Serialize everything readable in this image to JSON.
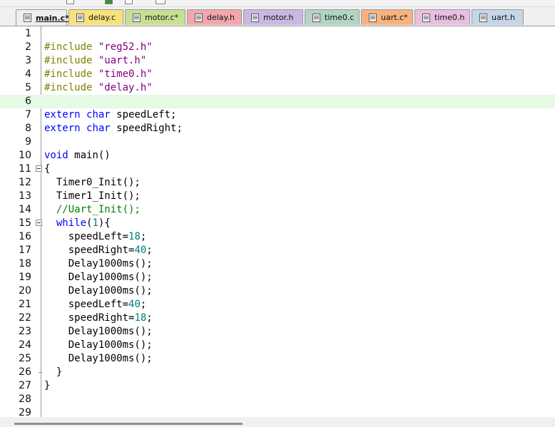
{
  "tabs": [
    {
      "label": "main.c*",
      "color": "#eeeeee",
      "active": true
    },
    {
      "label": "delay.c",
      "color": "#f9e27d"
    },
    {
      "label": "motor.c*",
      "color": "#c7df93"
    },
    {
      "label": "delay.h",
      "color": "#f3a6ad"
    },
    {
      "label": "motor.h",
      "color": "#c9b8e3"
    },
    {
      "label": "time0.c",
      "color": "#b2d4c3"
    },
    {
      "label": "uart.c*",
      "color": "#f7b27e"
    },
    {
      "label": "time0.h",
      "color": "#e8bfe0"
    },
    {
      "label": "uart.h",
      "color": "#c6d6e8"
    }
  ],
  "editor": {
    "current_line": 6,
    "lines": [
      {
        "n": "1",
        "tokens": []
      },
      {
        "n": "2",
        "tokens": [
          {
            "t": "#include ",
            "c": "pp"
          },
          {
            "t": "\"reg52.h\"",
            "c": "str"
          }
        ]
      },
      {
        "n": "3",
        "tokens": [
          {
            "t": "#include ",
            "c": "pp"
          },
          {
            "t": "\"uart.h\"",
            "c": "str"
          }
        ]
      },
      {
        "n": "4",
        "tokens": [
          {
            "t": "#include ",
            "c": "pp"
          },
          {
            "t": "\"time0.h\"",
            "c": "str"
          }
        ]
      },
      {
        "n": "5",
        "tokens": [
          {
            "t": "#include ",
            "c": "pp"
          },
          {
            "t": "\"delay.h\"",
            "c": "str"
          }
        ]
      },
      {
        "n": "6",
        "tokens": []
      },
      {
        "n": "7",
        "tokens": [
          {
            "t": "extern ",
            "c": "kw"
          },
          {
            "t": "char ",
            "c": "kw"
          },
          {
            "t": "speedLeft;",
            "c": ""
          }
        ]
      },
      {
        "n": "8",
        "tokens": [
          {
            "t": "extern ",
            "c": "kw"
          },
          {
            "t": "char ",
            "c": "kw"
          },
          {
            "t": "speedRight;",
            "c": ""
          }
        ]
      },
      {
        "n": "9",
        "tokens": []
      },
      {
        "n": "10",
        "tokens": [
          {
            "t": "void ",
            "c": "kw"
          },
          {
            "t": "main()",
            "c": ""
          }
        ]
      },
      {
        "n": "11",
        "fold": true,
        "tokens": [
          {
            "t": "{",
            "c": ""
          }
        ]
      },
      {
        "n": "12",
        "tokens": [
          {
            "t": "  Timer0_Init();",
            "c": ""
          }
        ]
      },
      {
        "n": "13",
        "tokens": [
          {
            "t": "  Timer1_Init();",
            "c": ""
          }
        ]
      },
      {
        "n": "14",
        "tokens": [
          {
            "t": "  //Uart_Init();",
            "c": "cmt"
          }
        ]
      },
      {
        "n": "15",
        "fold": true,
        "tokens": [
          {
            "t": "  ",
            "c": ""
          },
          {
            "t": "while",
            "c": "kw"
          },
          {
            "t": "(",
            "c": ""
          },
          {
            "t": "1",
            "c": "num"
          },
          {
            "t": "){",
            "c": ""
          }
        ]
      },
      {
        "n": "16",
        "tokens": [
          {
            "t": "    speedLeft=",
            "c": ""
          },
          {
            "t": "18",
            "c": "num"
          },
          {
            "t": ";",
            "c": ""
          }
        ]
      },
      {
        "n": "17",
        "tokens": [
          {
            "t": "    speedRight=",
            "c": ""
          },
          {
            "t": "40",
            "c": "num"
          },
          {
            "t": ";",
            "c": ""
          }
        ]
      },
      {
        "n": "18",
        "tokens": [
          {
            "t": "    Delay1000ms();",
            "c": ""
          }
        ]
      },
      {
        "n": "19",
        "tokens": [
          {
            "t": "    Delay1000ms();",
            "c": ""
          }
        ]
      },
      {
        "n": "20",
        "tokens": [
          {
            "t": "    Delay1000ms();",
            "c": ""
          }
        ]
      },
      {
        "n": "21",
        "tokens": [
          {
            "t": "    speedLeft=",
            "c": ""
          },
          {
            "t": "40",
            "c": "num"
          },
          {
            "t": ";",
            "c": ""
          }
        ]
      },
      {
        "n": "22",
        "tokens": [
          {
            "t": "    speedRight=",
            "c": ""
          },
          {
            "t": "18",
            "c": "num"
          },
          {
            "t": ";",
            "c": ""
          }
        ]
      },
      {
        "n": "23",
        "tokens": [
          {
            "t": "    Delay1000ms();",
            "c": ""
          }
        ]
      },
      {
        "n": "24",
        "tokens": [
          {
            "t": "    Delay1000ms();",
            "c": ""
          }
        ]
      },
      {
        "n": "25",
        "tokens": [
          {
            "t": "    Delay1000ms();",
            "c": ""
          }
        ]
      },
      {
        "n": "26",
        "foldend": true,
        "tokens": [
          {
            "t": "  }",
            "c": ""
          }
        ]
      },
      {
        "n": "27",
        "tokens": [
          {
            "t": "}",
            "c": ""
          }
        ]
      },
      {
        "n": "28",
        "tokens": []
      },
      {
        "n": "29",
        "tokens": []
      }
    ]
  }
}
